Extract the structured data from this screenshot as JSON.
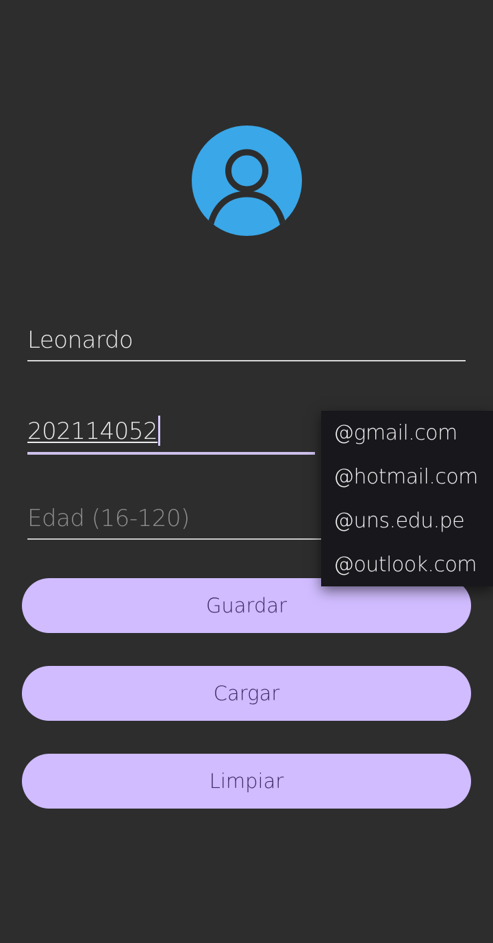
{
  "colors": {
    "background": "#2d2d2d",
    "avatar_blue": "#3aa7e8",
    "button_fill": "#d0bcff",
    "button_text": "#3c2b66",
    "dropdown_bg": "#18171c",
    "focus_underline": "#cdc1ec"
  },
  "avatar": {
    "icon": "account-circle-icon"
  },
  "form": {
    "name_value": "Leonardo",
    "code_value": "202114052",
    "age_placeholder": "Edad (16-120)"
  },
  "buttons": {
    "save_label": "Guardar",
    "load_label": "Cargar",
    "clear_label": "Limpiar"
  },
  "dropdown": {
    "items": [
      "@gmail.com",
      "@hotmail.com",
      "@uns.edu.pe",
      "@outlook.com"
    ]
  }
}
